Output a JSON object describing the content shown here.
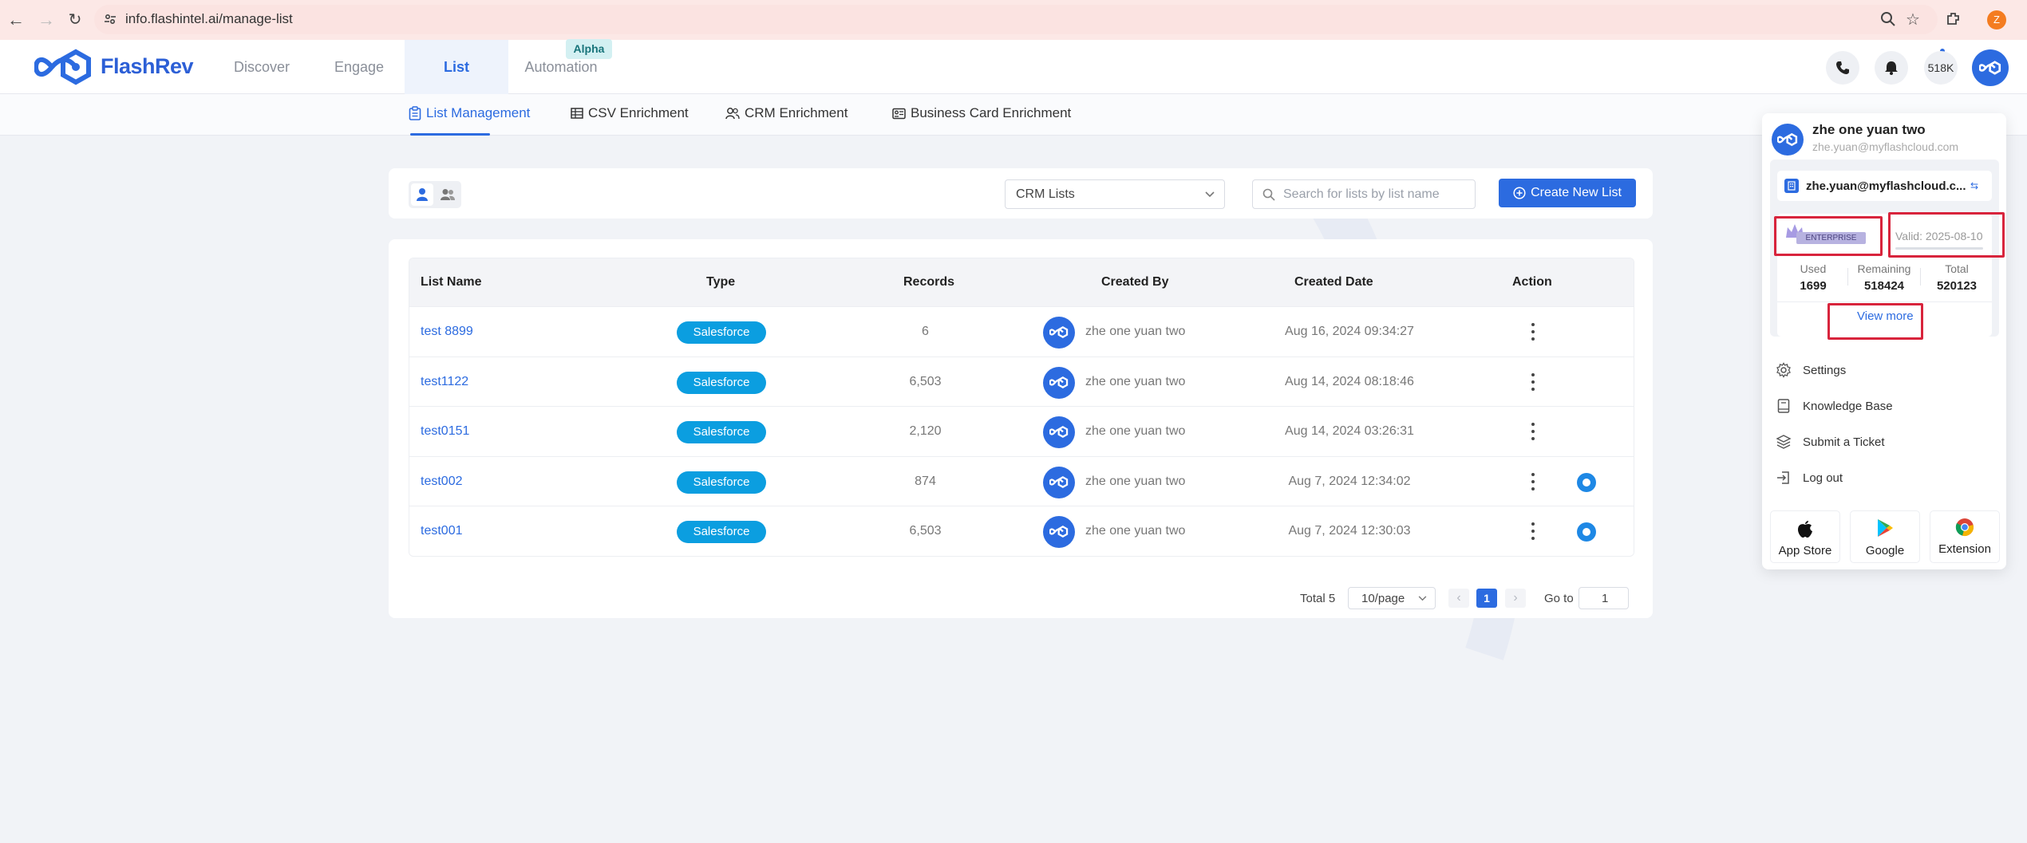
{
  "browser": {
    "url": "info.flashintel.ai/manage-list",
    "profile_initial": "Z"
  },
  "brand": {
    "name": "FlashRev",
    "color": "#2c6be0"
  },
  "top_nav": {
    "items": [
      "Discover",
      "Engage",
      "List",
      "Automation"
    ],
    "active": "List",
    "alpha_badge": "Alpha",
    "credits": "518K"
  },
  "sub_nav": {
    "tabs": [
      "List Management",
      "CSV Enrichment",
      "CRM Enrichment",
      "Business Card Enrichment"
    ],
    "active": "List Management"
  },
  "toolbar": {
    "list_source": "CRM Lists",
    "search_placeholder": "Search for lists by list name",
    "create_label": "Create New List"
  },
  "table": {
    "headers": [
      "List Name",
      "Type",
      "Records",
      "Created By",
      "Created Date",
      "Action"
    ],
    "rows": [
      {
        "name": "test 8899",
        "type": "Salesforce",
        "records": "6",
        "created_by": "zhe one yuan two",
        "date": "Aug 16, 2024 09:34:27",
        "status": false
      },
      {
        "name": "test1122",
        "type": "Salesforce",
        "records": "6,503",
        "created_by": "zhe one yuan two",
        "date": "Aug 14, 2024 08:18:46",
        "status": false
      },
      {
        "name": "test0151",
        "type": "Salesforce",
        "records": "2,120",
        "created_by": "zhe one yuan two",
        "date": "Aug 14, 2024 03:26:31",
        "status": false
      },
      {
        "name": "test002",
        "type": "Salesforce",
        "records": "874",
        "created_by": "zhe one yuan two",
        "date": "Aug 7, 2024 12:34:02",
        "status": true
      },
      {
        "name": "test001",
        "type": "Salesforce",
        "records": "6,503",
        "created_by": "zhe one yuan two",
        "date": "Aug 7, 2024 12:30:03",
        "status": true
      }
    ]
  },
  "pagination": {
    "total": "Total 5",
    "page_size": "10/page",
    "current": "1",
    "goto_label": "Go to",
    "goto_value": "1"
  },
  "user_menu": {
    "name": "zhe one yuan two",
    "email": "zhe.yuan@myflashcloud.com",
    "company": "zhe.yuan@myflashcloud.c...",
    "plan": "ENTERPRISE",
    "valid": "Valid: 2025-08-10",
    "stats": [
      {
        "label": "Used",
        "value": "1699"
      },
      {
        "label": "Remaining",
        "value": "518424"
      },
      {
        "label": "Total",
        "value": "520123"
      }
    ],
    "view_more": "View more",
    "items": [
      "Settings",
      "Knowledge Base",
      "Submit a Ticket",
      "Log out"
    ],
    "stores": [
      "App Store",
      "Google",
      "Extension"
    ]
  }
}
